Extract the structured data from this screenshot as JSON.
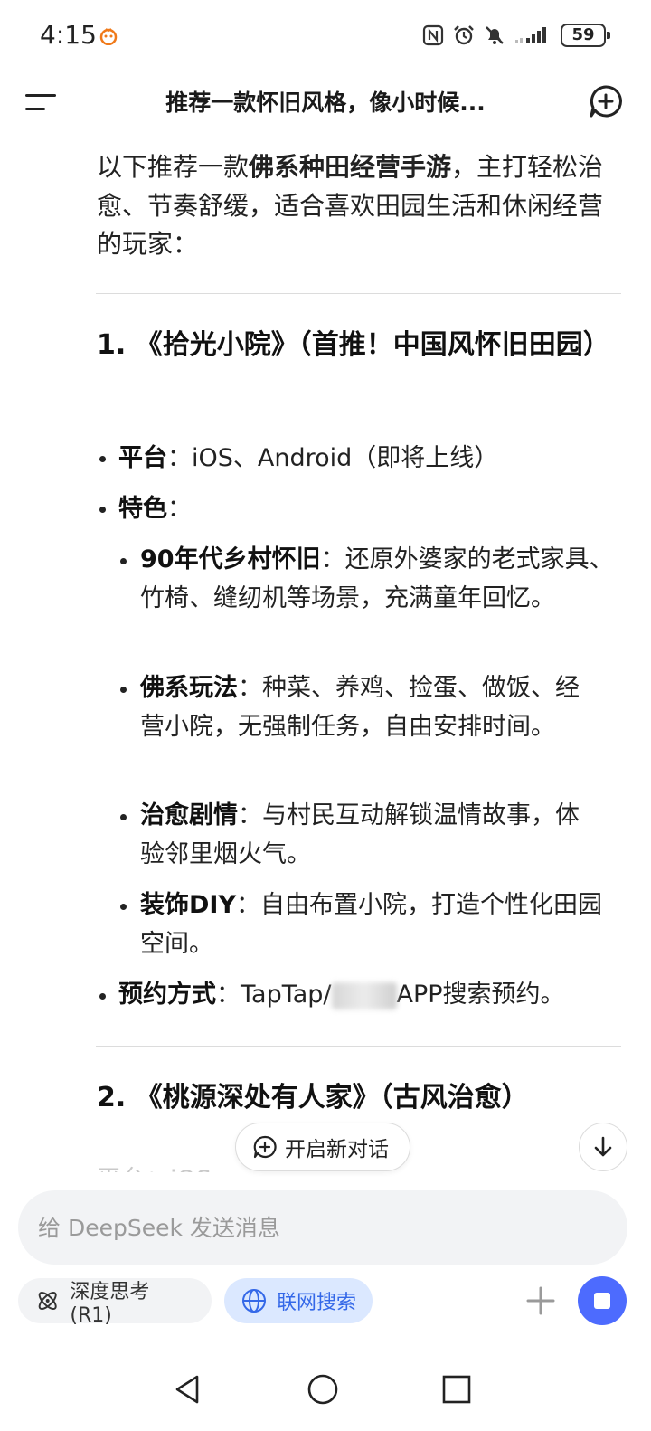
{
  "status_bar": {
    "time": "4:15",
    "battery": "59",
    "icons": [
      "notification-face-icon",
      "nfc-icon",
      "alarm-icon",
      "mute-icon",
      "signal-icon",
      "battery-icon"
    ]
  },
  "header": {
    "title": "推荐一款怀旧风格，像小时候...",
    "icons": [
      "menu-icon",
      "new-chat-icon"
    ]
  },
  "message": {
    "intro": {
      "before": "以下推荐一款",
      "bold": "佛系种田经营手游",
      "after": "，主打轻松治愈、节奏舒缓，适合喜欢田园生活和休闲经营的玩家："
    },
    "game1": {
      "heading": "1. 《拾光小院》（首推！中国风怀旧田园）",
      "platform_label": "平台",
      "platform_value": "：iOS、Android（即将上线）",
      "features_label": "特色",
      "features_colon": "：",
      "features": [
        {
          "label": "90年代乡村怀旧",
          "text": "：还原外婆家的老式家具、竹椅、缝纫机等场景，充满童年回忆。"
        },
        {
          "label": "佛系玩法",
          "text": "：种菜、养鸡、捡蛋、做饭、经营小院，无强制任务，自由安排时间。"
        },
        {
          "label": "治愈剧情",
          "text": "：与村民互动解锁温情故事，体验邻里烟火气。"
        },
        {
          "label": "装饰DIY",
          "text": "：自由布置小院，打造个性化田园空间。"
        }
      ],
      "reserve_label": "预约方式",
      "reserve_before": "：TapTap/",
      "reserve_after": "APP搜索预约。"
    },
    "game2": {
      "heading": "2. 《桃源深处有人家》（古风治愈）",
      "faded_line": "平台：iOS"
    }
  },
  "floating": {
    "new_chat_label": "开启新对话",
    "icons": [
      "new-chat-small-icon",
      "arrow-down-icon"
    ]
  },
  "composer": {
    "placeholder": "给 DeepSeek 发送消息",
    "value": "",
    "deep_think_label": "深度思考 (R1)",
    "web_search_label": "联网搜索",
    "icons": [
      "atom-icon",
      "globe-icon",
      "plus-icon",
      "stop-icon"
    ]
  },
  "colors": {
    "accent": "#4d6bfe",
    "web_search_bg": "#dbe8ff",
    "web_search_text": "#3468e8",
    "composer_bg": "#f2f3f5"
  },
  "nav_bar": {
    "icons": [
      "back-icon",
      "home-icon",
      "recents-icon"
    ]
  }
}
